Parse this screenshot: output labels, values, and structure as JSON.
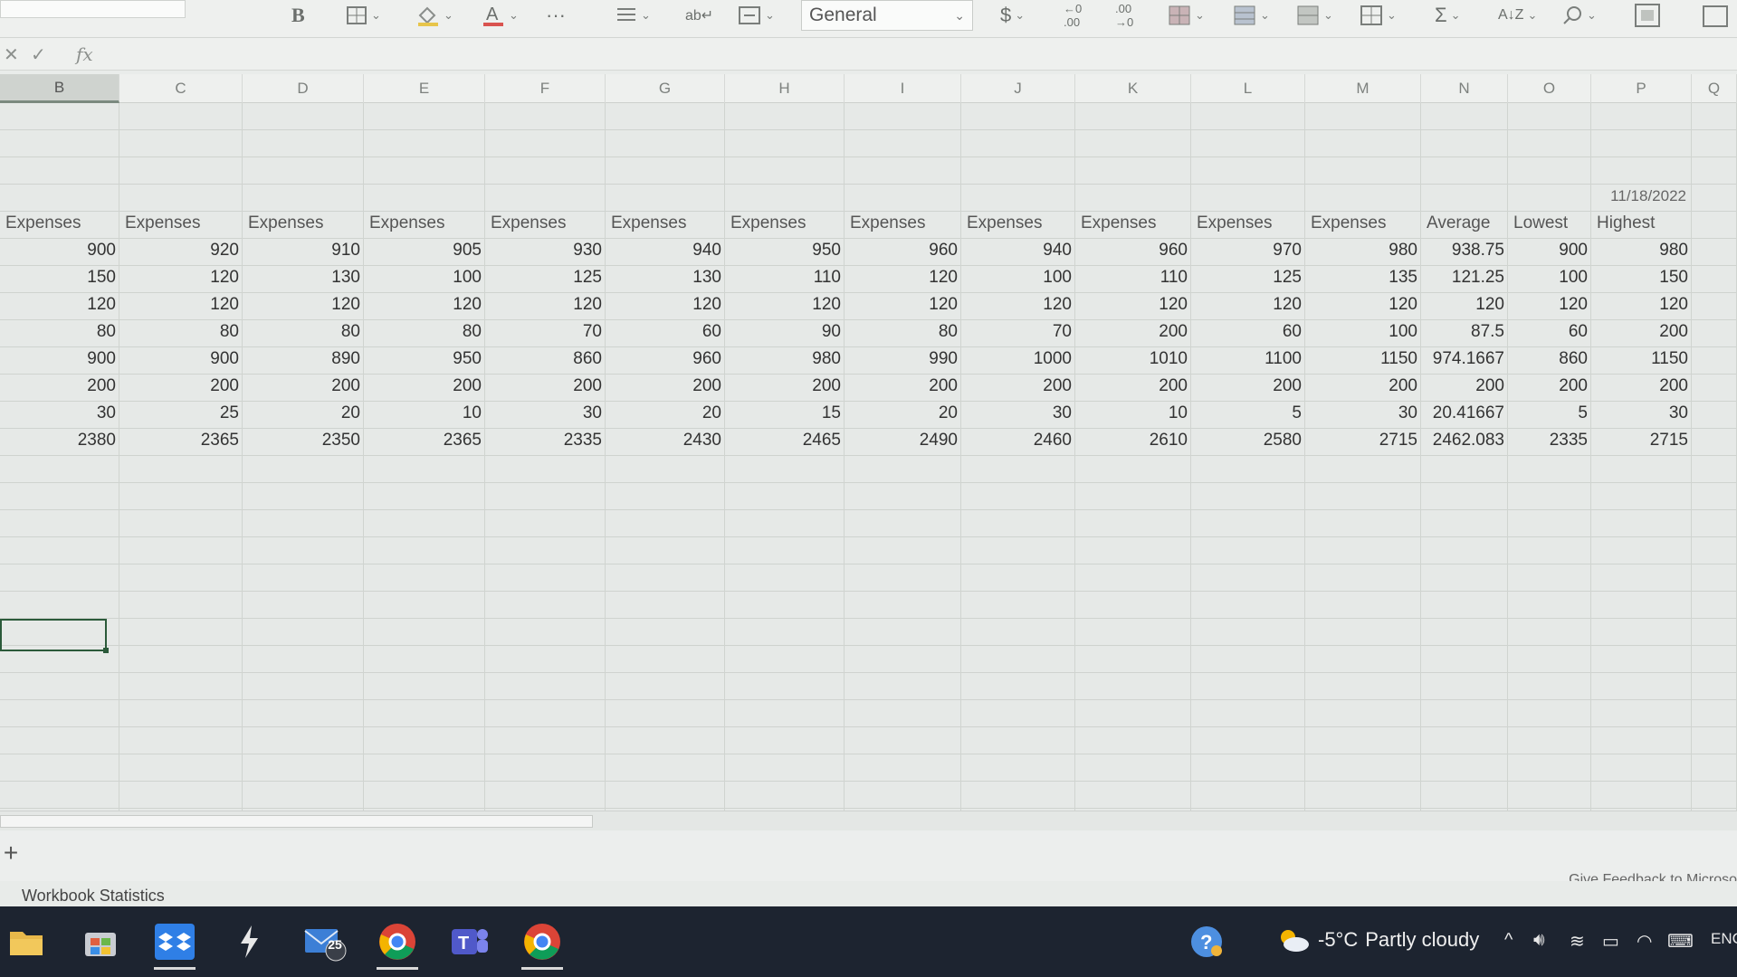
{
  "ribbon": {
    "number_format": "General",
    "icons": [
      "bold-icon",
      "borders-icon",
      "fill-color-icon",
      "font-color-icon",
      "more-icon",
      "align-icon",
      "wrap-text-icon",
      "merge-icon",
      "currency-icon",
      "increase-decimal-icon",
      "decrease-decimal-icon",
      "conditional-format-icon",
      "format-table-icon",
      "cell-styles-icon",
      "insert-cells-icon",
      "autosum-icon",
      "sort-filter-icon",
      "find-icon",
      "addins-icon"
    ],
    "accent_colors": {
      "font_color": "#d9534f",
      "fill_color": "#e7c54a"
    }
  },
  "formula_bar": {
    "fx": "fx"
  },
  "columns": [
    "B",
    "C",
    "D",
    "E",
    "F",
    "G",
    "H",
    "I",
    "J",
    "K",
    "L",
    "M",
    "N",
    "O",
    "P",
    "Q"
  ],
  "date": "11/18/2022",
  "headers": [
    "Expenses",
    "Expenses",
    "Expenses",
    "Expenses",
    "Expenses",
    "Expenses",
    "Expenses",
    "Expenses",
    "Expenses",
    "Expenses",
    "Expenses",
    "Expenses",
    "Average",
    "Lowest",
    "Highest"
  ],
  "rows": [
    [
      "900",
      "920",
      "910",
      "905",
      "930",
      "940",
      "950",
      "960",
      "940",
      "960",
      "970",
      "980",
      "938.75",
      "900",
      "980"
    ],
    [
      "150",
      "120",
      "130",
      "100",
      "125",
      "130",
      "110",
      "120",
      "100",
      "110",
      "125",
      "135",
      "121.25",
      "100",
      "150"
    ],
    [
      "120",
      "120",
      "120",
      "120",
      "120",
      "120",
      "120",
      "120",
      "120",
      "120",
      "120",
      "120",
      "120",
      "120",
      "120"
    ],
    [
      "80",
      "80",
      "80",
      "80",
      "70",
      "60",
      "90",
      "80",
      "70",
      "200",
      "60",
      "100",
      "87.5",
      "60",
      "200"
    ],
    [
      "900",
      "900",
      "890",
      "950",
      "860",
      "960",
      "980",
      "990",
      "1000",
      "1010",
      "1100",
      "1150",
      "974.1667",
      "860",
      "1150"
    ],
    [
      "200",
      "200",
      "200",
      "200",
      "200",
      "200",
      "200",
      "200",
      "200",
      "200",
      "200",
      "200",
      "200",
      "200",
      "200"
    ],
    [
      "30",
      "25",
      "20",
      "10",
      "30",
      "20",
      "15",
      "20",
      "30",
      "10",
      "5",
      "30",
      "20.41667",
      "5",
      "30"
    ],
    [
      "2380",
      "2365",
      "2350",
      "2365",
      "2335",
      "2430",
      "2465",
      "2490",
      "2460",
      "2610",
      "2580",
      "2715",
      "2462.083",
      "2335",
      "2715"
    ]
  ],
  "sheet": {
    "add_label": "+"
  },
  "status": {
    "text": "Workbook Statistics",
    "feedback": "Give Feedback to Microso"
  },
  "taskbar": {
    "mail_badge": "25",
    "weather": {
      "temp": "-5°C",
      "condition": "Partly cloudy"
    },
    "lang": "ENG",
    "apps": [
      "file-explorer-icon",
      "store-icon",
      "dropbox-icon",
      "app-icon",
      "mail-icon",
      "chrome-icon",
      "teams-icon",
      "chrome-icon"
    ]
  }
}
